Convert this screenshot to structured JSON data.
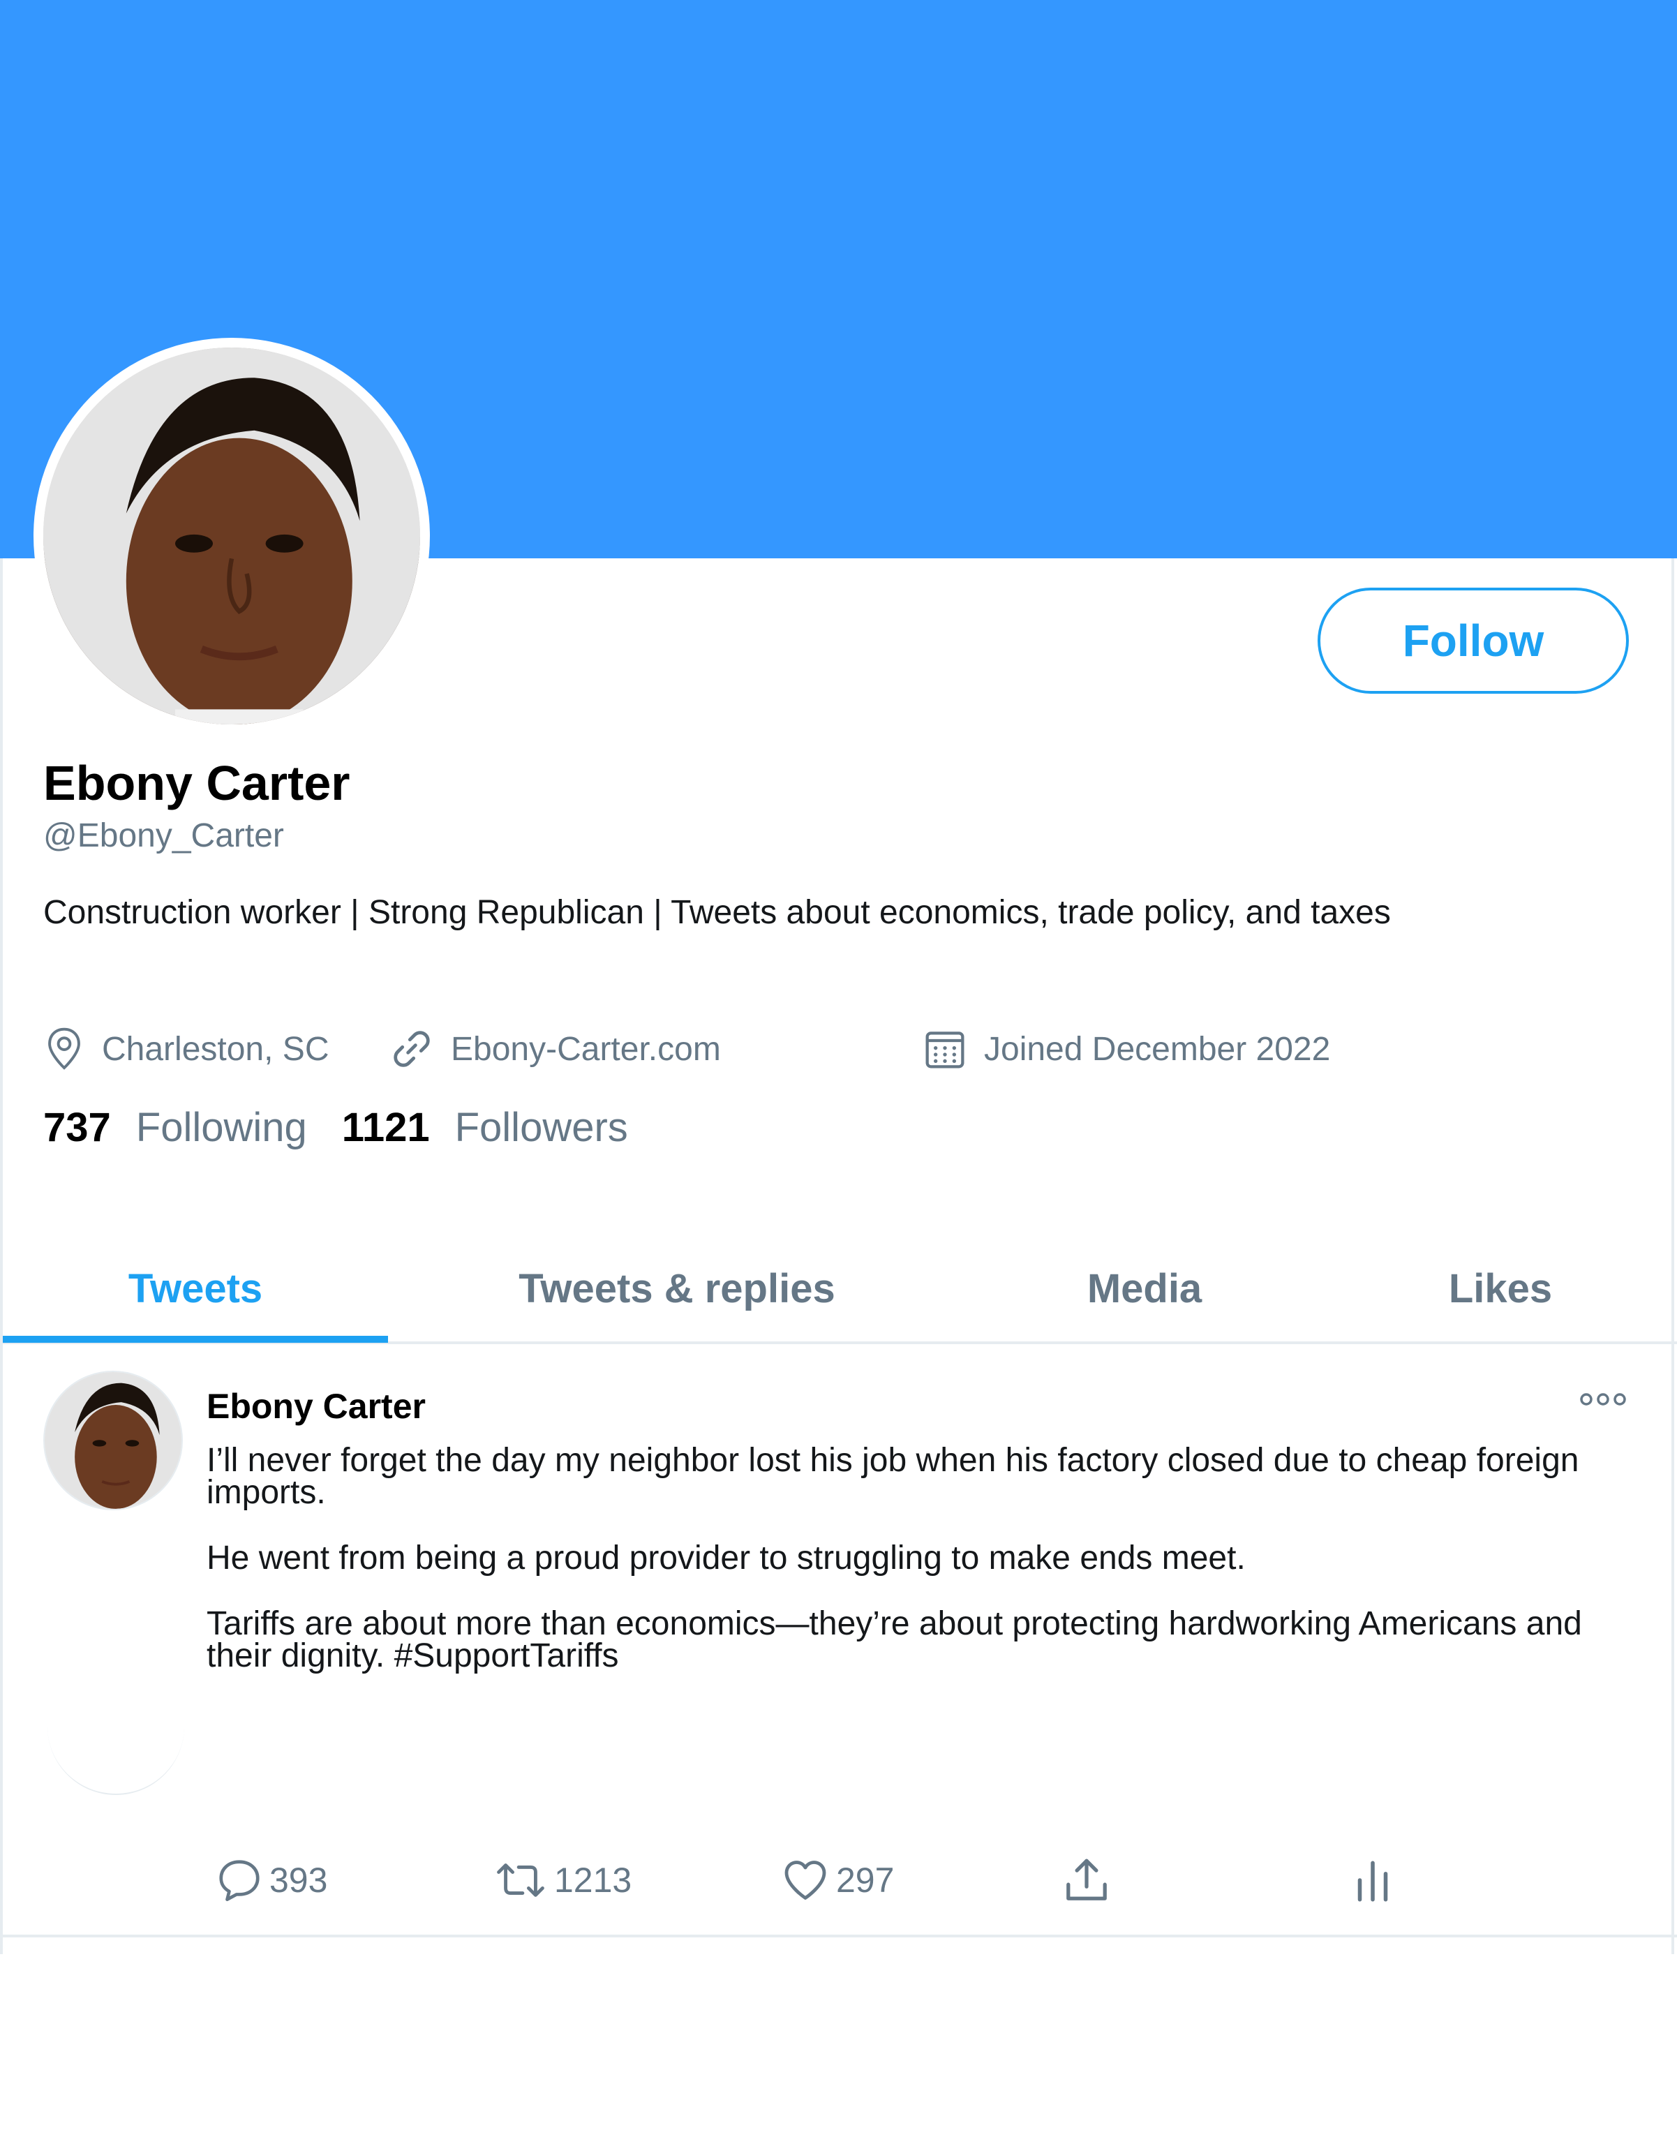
{
  "colors": {
    "banner": "#3497ff",
    "accent": "#1da1f2",
    "muted": "#657786",
    "text": "#14171a",
    "border": "#e6ecf0"
  },
  "profile": {
    "follow_label": "Follow",
    "name": "Ebony Carter",
    "handle": "@Ebony_Carter",
    "bio": "Construction worker | Strong Republican | Tweets about economics, trade policy, and taxes",
    "location": "Charleston, SC",
    "website": "Ebony-Carter.com",
    "joined": "Joined December 2022",
    "following_count": "737",
    "following_label": "Following",
    "followers_count": "1121",
    "followers_label": "Followers"
  },
  "icons": {
    "location": "location-pin-icon",
    "link": "link-icon",
    "calendar": "calendar-icon",
    "more": "more-icon",
    "reply": "reply-icon",
    "retweet": "retweet-icon",
    "like": "heart-icon",
    "share": "share-icon",
    "analytics": "analytics-icon"
  },
  "tabs": [
    {
      "label": "Tweets",
      "active": true
    },
    {
      "label": "Tweets & replies",
      "active": false
    },
    {
      "label": "Media",
      "active": false
    },
    {
      "label": "Likes",
      "active": false
    }
  ],
  "tweet": {
    "author": "Ebony Carter",
    "paragraphs": [
      "I’ll never forget the day my neighbor lost his job when his factory closed due to cheap foreign imports.",
      "He went from being a proud provider to struggling to make ends meet.",
      "Tariffs are about more than economics—they’re about protecting hardworking Americans and their dignity. #SupportTariffs"
    ],
    "replies": "393",
    "retweets": "1213",
    "likes": "297"
  }
}
